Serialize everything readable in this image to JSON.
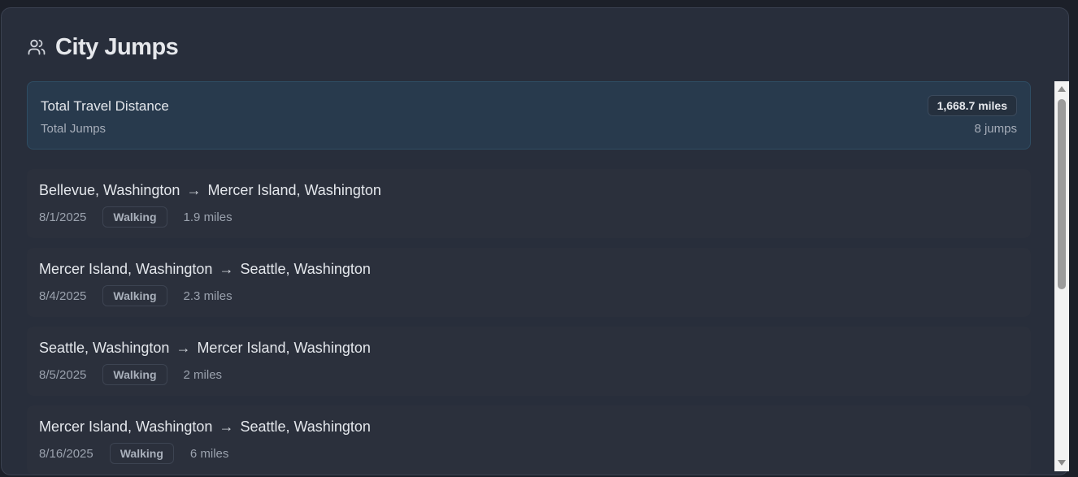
{
  "header": {
    "title": "City Jumps",
    "icon": "users-icon"
  },
  "summary": {
    "total_label": "Total Travel Distance",
    "total_value": "1,668.7 miles",
    "jumps_label": "Total Jumps",
    "jumps_value": "8 jumps"
  },
  "jumps": [
    {
      "from": "Bellevue, Washington",
      "arrow": "→",
      "to": "Mercer Island, Washington",
      "date": "8/1/2025",
      "mode": "Walking",
      "distance": "1.9 miles"
    },
    {
      "from": "Mercer Island, Washington",
      "arrow": "→",
      "to": "Seattle, Washington",
      "date": "8/4/2025",
      "mode": "Walking",
      "distance": "2.3 miles"
    },
    {
      "from": "Seattle, Washington",
      "arrow": "→",
      "to": "Mercer Island, Washington",
      "date": "8/5/2025",
      "mode": "Walking",
      "distance": "2 miles"
    },
    {
      "from": "Mercer Island, Washington",
      "arrow": "→",
      "to": "Seattle, Washington",
      "date": "8/16/2025",
      "mode": "Walking",
      "distance": "6 miles"
    }
  ],
  "colors": {
    "background": "#282e3b",
    "summary_bg": "#283a4d",
    "item_bg": "#2b303c",
    "text": "#e4e7ec",
    "muted": "#9ba2ae"
  }
}
